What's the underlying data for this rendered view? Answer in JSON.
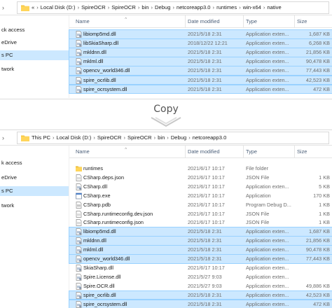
{
  "top": {
    "breadcrumb": [
      "«",
      "Local Disk (D:)",
      "SpireOCR",
      "SpireOCR",
      "bin",
      "Debug",
      "netcoreapp3.0",
      "runtimes",
      "win-x64",
      "native"
    ],
    "nav": [
      "ck access",
      "eDrive",
      "s PC",
      "twork"
    ],
    "headers": {
      "name": "Name",
      "date": "Date modified",
      "type": "Type",
      "size": "Size"
    },
    "rows": [
      {
        "name": "libiomp5md.dll",
        "date": "2021/5/18 2:31",
        "type": "Application exten...",
        "size": "1,687 KB",
        "icon": "dll-icon"
      },
      {
        "name": "libSkiaSharp.dll",
        "date": "2018/12/22 12:21",
        "type": "Application exten...",
        "size": "6,268 KB",
        "icon": "dll-icon"
      },
      {
        "name": "mkldnn.dll",
        "date": "2021/5/18 2:31",
        "type": "Application exten...",
        "size": "21,856 KB",
        "icon": "dll-icon"
      },
      {
        "name": "mklml.dll",
        "date": "2021/5/18 2:31",
        "type": "Application exten...",
        "size": "90,478 KB",
        "icon": "dll-icon"
      },
      {
        "name": "opencv_world346.dll",
        "date": "2021/5/18 2:31",
        "type": "Application exten...",
        "size": "77,443 KB",
        "icon": "dll-icon"
      },
      {
        "name": "spire_ocrlib.dll",
        "date": "2021/5/18 2:31",
        "type": "Application exten...",
        "size": "42,523 KB",
        "icon": "dll-icon"
      },
      {
        "name": "spire_ocrsystem.dll",
        "date": "2021/5/18 2:31",
        "type": "Application exten...",
        "size": "472 KB",
        "icon": "dll-icon"
      }
    ]
  },
  "copy": {
    "label": "Copy"
  },
  "bottom": {
    "breadcrumb": [
      "This PC",
      "Local Disk (D:)",
      "SpireOCR",
      "SpireOCR",
      "bin",
      "Debug",
      "netcoreapp3.0"
    ],
    "nav": [
      "k access",
      "eDrive",
      "s PC",
      "twork"
    ],
    "headers": {
      "name": "Name",
      "date": "Date modified",
      "type": "Type",
      "size": "Size"
    },
    "rows": [
      {
        "name": "runtimes",
        "date": "2021/6/17 10:17",
        "type": "File folder",
        "size": "",
        "icon": "folder-icon"
      },
      {
        "name": "CSharp.deps.json",
        "date": "2021/6/17 10:17",
        "type": "JSON File",
        "size": "1 KB",
        "icon": "json-file-icon"
      },
      {
        "name": "CSharp.dll",
        "date": "2021/6/17 10:17",
        "type": "Application exten...",
        "size": "5 KB",
        "icon": "dll-icon"
      },
      {
        "name": "CSharp.exe",
        "date": "2021/6/17 10:17",
        "type": "Application",
        "size": "170 KB",
        "icon": "exe-icon"
      },
      {
        "name": "CSharp.pdb",
        "date": "2021/6/17 10:17",
        "type": "Program Debug D...",
        "size": "1 KB",
        "icon": "pdb-icon"
      },
      {
        "name": "CSharp.runtimeconfig.dev.json",
        "date": "2021/6/17 10:17",
        "type": "JSON File",
        "size": "1 KB",
        "icon": "json-file-icon"
      },
      {
        "name": "CSharp.runtimeconfig.json",
        "date": "2021/6/17 10:17",
        "type": "JSON File",
        "size": "1 KB",
        "icon": "json-file-icon"
      },
      {
        "name": "libiomp5md.dll",
        "date": "2021/5/18 2:31",
        "type": "Application exten...",
        "size": "1,687 KB",
        "icon": "dll-icon"
      },
      {
        "name": "mkldnn.dll",
        "date": "2021/5/18 2:31",
        "type": "Application exten...",
        "size": "21,856 KB",
        "icon": "dll-icon"
      },
      {
        "name": "mklml.dll",
        "date": "2021/5/18 2:31",
        "type": "Application exten...",
        "size": "90,478 KB",
        "icon": "dll-icon"
      },
      {
        "name": "opencv_world346.dll",
        "date": "2021/5/18 2:31",
        "type": "Application exten...",
        "size": "77,443 KB",
        "icon": "dll-icon"
      },
      {
        "name": "SkiaSharp.dll",
        "date": "2021/6/17 10:17",
        "type": "Application exten...",
        "size": "",
        "icon": "dll-icon"
      },
      {
        "name": "Spire.License.dll",
        "date": "2021/5/27 9:03",
        "type": "Application exten...",
        "size": "",
        "icon": "dll-icon"
      },
      {
        "name": "Spire.OCR.dll",
        "date": "2021/5/27 9:03",
        "type": "Application exten...",
        "size": "49,886 KB",
        "icon": "dll-icon"
      },
      {
        "name": "spire_ocrlib.dll",
        "date": "2021/5/18 2:31",
        "type": "Application exten...",
        "size": "42,523 KB",
        "icon": "dll-icon"
      },
      {
        "name": "spire_ocrsystem.dll",
        "date": "2021/5/18 2:31",
        "type": "Application exten...",
        "size": "472 KB",
        "icon": "dll-icon"
      }
    ]
  },
  "colors": {
    "selection": "#cce8ff",
    "selection_border": "#99d1ff",
    "folder": "#f4c542",
    "header_text": "#4c607a"
  }
}
